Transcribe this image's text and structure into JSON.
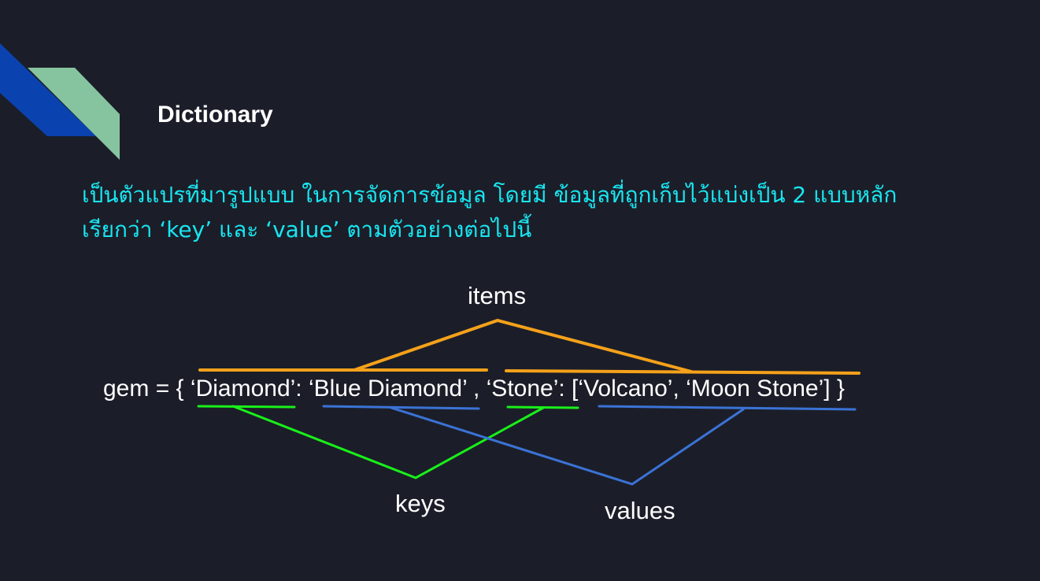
{
  "slide": {
    "title": "Dictionary",
    "description_lines": [
      "เป็นตัวแปรที่มารูปแบบ ในการจัดการข้อมูล โดยมี ข้อมูลที่ถูกเก็บไว้แบ่งเป็น 2 แบบหลัก",
      "เรียกว่า ‘key’ และ ‘value’ ตามตัวอย่างต่อไปนี้"
    ]
  },
  "diagram": {
    "code": {
      "prefix": "gem = { ",
      "key1": "‘Diamond’",
      "sep1": ": ",
      "value1": "‘Blue Diamond’",
      "sep2": " , ",
      "key2": "‘Stone’",
      "sep3": ": ",
      "value2": "[‘Volcano’, ‘Moon Stone’]",
      "suffix": " }"
    },
    "labels": {
      "items": "items",
      "keys": "keys",
      "values": "values"
    },
    "colors": {
      "items": "#f5a11a",
      "keys": "#19f019",
      "values": "#3b73d6",
      "text": "#ffffff",
      "description": "#18e6f0",
      "background": "#1b1e29"
    },
    "decoration_colors": {
      "dark_blue": "#0a43b0",
      "mint": "#86c4a0"
    }
  }
}
